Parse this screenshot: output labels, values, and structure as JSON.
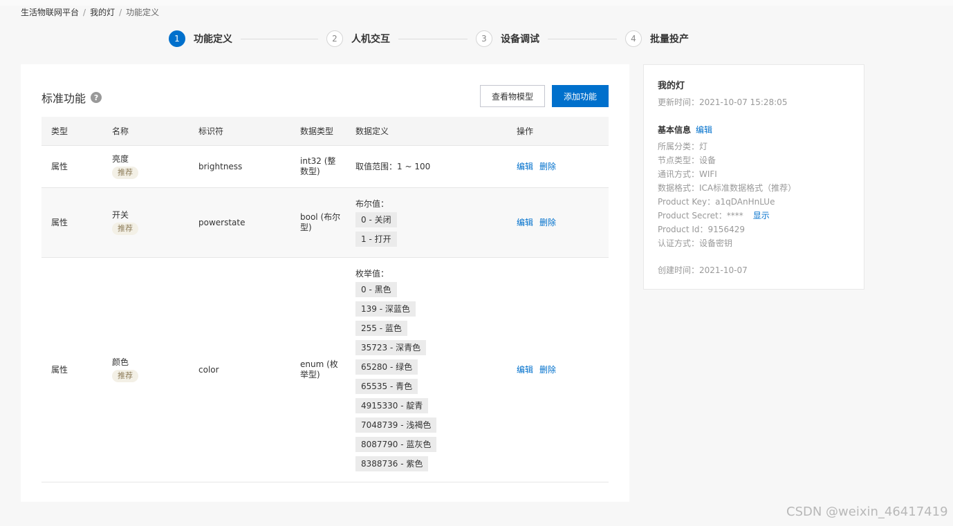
{
  "breadcrumb": {
    "items": [
      "生活物联网平台",
      "我的灯",
      "功能定义"
    ],
    "separator": "/"
  },
  "steps": [
    {
      "num": "1",
      "label": "功能定义",
      "active": true
    },
    {
      "num": "2",
      "label": "人机交互",
      "active": false
    },
    {
      "num": "3",
      "label": "设备调试",
      "active": false
    },
    {
      "num": "4",
      "label": "批量投产",
      "active": false
    }
  ],
  "main": {
    "title": "标准功能",
    "help": "?",
    "view_model_button": "查看物模型",
    "add_button": "添加功能",
    "columns": [
      "类型",
      "名称",
      "标识符",
      "数据类型",
      "数据定义",
      "操作"
    ],
    "rows": [
      {
        "type": "属性",
        "name": "亮度",
        "tag": "推荐",
        "identifier": "brightness",
        "dtype": "int32 (整数型)",
        "def_title": "取值范围：1 ~ 100",
        "chips": [],
        "edit": "编辑",
        "delete": "删除"
      },
      {
        "type": "属性",
        "name": "开关",
        "tag": "推荐",
        "identifier": "powerstate",
        "dtype": "bool (布尔型)",
        "def_title": "布尔值：",
        "chips": [
          "0 - 关闭",
          "1 - 打开"
        ],
        "edit": "编辑",
        "delete": "删除"
      },
      {
        "type": "属性",
        "name": "颜色",
        "tag": "推荐",
        "identifier": "color",
        "dtype": "enum (枚举型)",
        "def_title": "枚举值：",
        "chips": [
          "0 - 黑色",
          "139 - 深蓝色",
          "255 - 蓝色",
          "35723 - 深青色",
          "65280 - 绿色",
          "65535 - 青色",
          "4915330 - 靛青",
          "7048739 - 浅褐色",
          "8087790 - 蓝灰色",
          "8388736 - 紫色"
        ],
        "edit": "编辑",
        "delete": "删除"
      }
    ]
  },
  "side": {
    "title": "我的灯",
    "updated": "更新时间：2021-10-07 15:28:05",
    "basic_info": "基本信息",
    "basic_edit": "编辑",
    "category": "所属分类：灯",
    "node_type": "节点类型：设备",
    "comm": "通讯方式：WIFI",
    "data_format": "数据格式：ICA标准数据格式（推荐）",
    "product_key": "Product Key：a1qDAnHnLUe",
    "product_secret": "Product Secret：****",
    "show": "显示",
    "product_id": "Product Id：9156429",
    "auth": "认证方式：设备密钥",
    "created": "创建时间：2021-10-07"
  },
  "watermark": "CSDN @weixin_46417419",
  "colors": {
    "primary": "#0070cc",
    "tag_bg": "#f3f0e6",
    "tag_text": "#8f7e5b"
  }
}
